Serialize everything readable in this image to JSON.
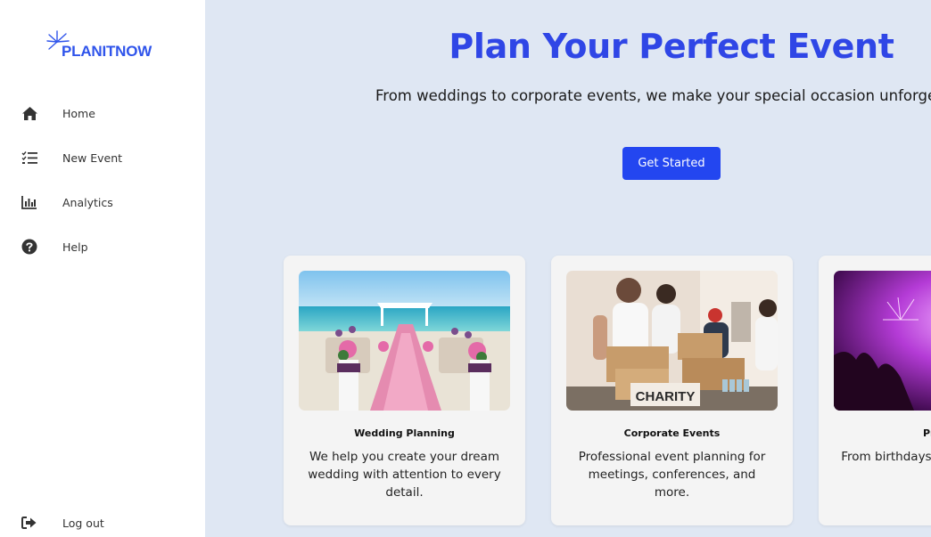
{
  "brand": {
    "name": "PLANITNOW",
    "color": "#2f54eb"
  },
  "sidebar": {
    "items": [
      {
        "label": "Home",
        "icon": "home-icon"
      },
      {
        "label": "New Event",
        "icon": "checklist-icon"
      },
      {
        "label": "Analytics",
        "icon": "bar-chart-icon"
      },
      {
        "label": "Help",
        "icon": "question-circle-icon"
      }
    ],
    "logout": {
      "label": "Log out",
      "icon": "logout-icon"
    }
  },
  "hero": {
    "title": "Plan Your Perfect Event",
    "subtitle": "From weddings to corporate events, we make your special occasion unforgett",
    "cta_label": "Get Started"
  },
  "cards": [
    {
      "title": "Wedding Planning",
      "description": "We help you create your dream wedding with attention to every detail.",
      "image": "beach-wedding-photo"
    },
    {
      "title": "Corporate Events",
      "description": "Professional event planning for meetings, conferences, and more.",
      "image": "charity-volunteers-photo",
      "image_text": "CHARITY"
    },
    {
      "title": "Privat",
      "description": "From birthdays we make every c",
      "image": "concert-fireworks-photo"
    }
  ],
  "colors": {
    "accent": "#2346f0",
    "title": "#2f46e6",
    "background": "#dfe7f3"
  }
}
